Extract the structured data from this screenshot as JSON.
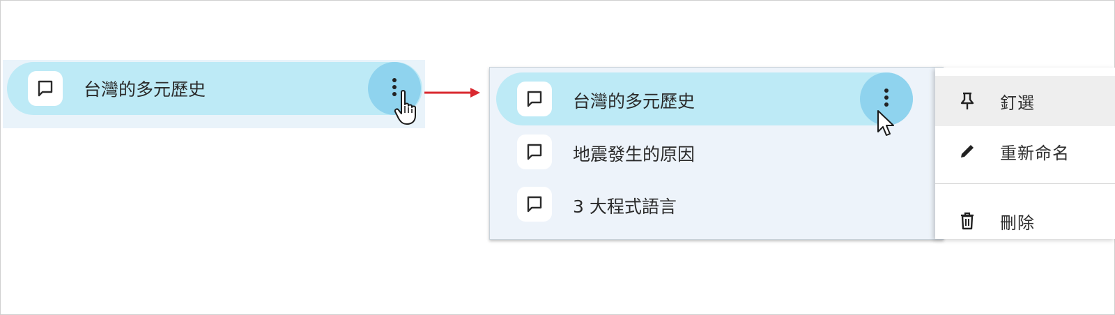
{
  "left_state": {
    "chat": {
      "title": "台灣的多元歷史",
      "icon": "chat-bubble-icon"
    },
    "more_icon": "more-vert-icon",
    "cursor": "hand-pointer-cursor"
  },
  "arrow": {
    "color": "#d9282f"
  },
  "right_state": {
    "chats": [
      {
        "title": "台灣的多元歷史",
        "icon": "chat-bubble-icon",
        "active": true
      },
      {
        "title": "地震發生的原因",
        "icon": "chat-bubble-icon",
        "active": false
      },
      {
        "title": "3 大程式語言",
        "icon": "chat-bubble-icon",
        "active": false
      }
    ],
    "more_icon": "more-vert-icon",
    "cursor": "arrow-cursor",
    "menu": {
      "items": [
        {
          "label": "釘選",
          "icon": "pin-icon",
          "hovered": true
        },
        {
          "label": "重新命名",
          "icon": "pencil-icon",
          "hovered": false
        },
        {
          "label": "刪除",
          "icon": "trash-icon",
          "hovered": false
        }
      ]
    }
  },
  "colors": {
    "active_row": "#bdeaf6",
    "more_button": "#8fd3ee",
    "sidebar_bg": "#edf3fa",
    "menu_bg": "#ffffff"
  }
}
